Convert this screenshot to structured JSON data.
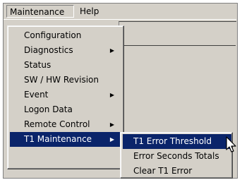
{
  "menubar": {
    "items": [
      {
        "label": "Maintenance"
      },
      {
        "label": "Help"
      }
    ]
  },
  "maintenance_menu": {
    "items": [
      {
        "label": "Configuration"
      },
      {
        "label": "Diagnostics",
        "has_submenu": true
      },
      {
        "label": "Status"
      },
      {
        "label": "SW / HW Revision"
      },
      {
        "label": "Event",
        "has_submenu": true
      },
      {
        "label": "Logon Data"
      },
      {
        "label": "Remote Control",
        "has_submenu": true
      },
      {
        "label": "T1 Maintenance",
        "has_submenu": true,
        "highlighted": true
      }
    ]
  },
  "t1_submenu": {
    "items": [
      {
        "label": "T1 Error Threshold",
        "highlighted": true
      },
      {
        "label": "Error Seconds Totals"
      },
      {
        "label": "Clear T1 Error"
      }
    ]
  },
  "icons": {
    "submenu_arrow": "triangle-right",
    "cursor": "arrow-pointer"
  },
  "colors": {
    "menu_background": "#d4d0c8",
    "highlight": "#0a246a",
    "highlight_text": "#ffffff"
  }
}
